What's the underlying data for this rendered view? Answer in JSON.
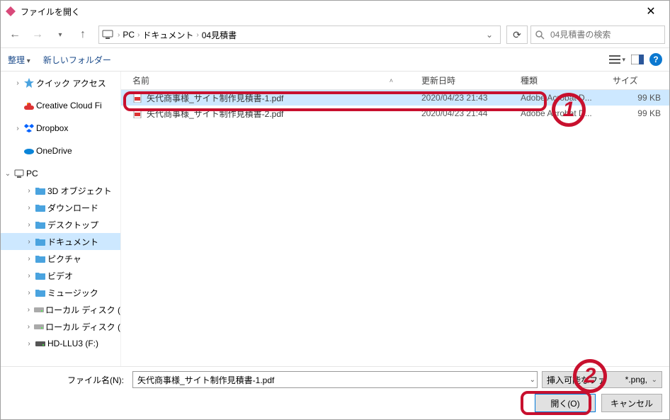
{
  "window_title": "ファイルを開く",
  "breadcrumb": {
    "icon": "pc",
    "parts": [
      "PC",
      "ドキュメント",
      "04見積書"
    ]
  },
  "search_placeholder": "04見積書の検索",
  "toolbar": {
    "organize": "整理",
    "newfolder": "新しいフォルダー"
  },
  "columns": {
    "name": "名前",
    "date": "更新日時",
    "type": "種類",
    "size": "サイズ"
  },
  "files": [
    {
      "name": "矢代商事様_サイト制作見積書-1.pdf",
      "date": "2020/04/23 21:43",
      "type": "Adobe Acrobat D...",
      "size": "99 KB",
      "selected": true
    },
    {
      "name": "矢代商事様_サイト制作見積書-2.pdf",
      "date": "2020/04/23 21:44",
      "type": "Adobe Acrobat D...",
      "size": "99 KB",
      "selected": false
    }
  ],
  "sidebar": {
    "quick_access": "クイック アクセス",
    "creative_cloud": "Creative Cloud Fi",
    "dropbox": "Dropbox",
    "onedrive": "OneDrive",
    "pc": "PC",
    "children": [
      "3D オブジェクト",
      "ダウンロード",
      "デスクトップ",
      "ドキュメント",
      "ピクチャ",
      "ビデオ",
      "ミュージック",
      "ローカル ディスク (",
      "ローカル ディスク (",
      "HD-LLU3 (F:)"
    ],
    "selected_index": 3
  },
  "bottom": {
    "filename_label": "ファイル名(N):",
    "filename_value": "矢代商事様_サイト制作見積書-1.pdf",
    "filter_label": "挿入可能なファイル(*.png, ...)",
    "filter_display": "挿入可能なファ",
    "filter_tail": "*.png,",
    "open": "開く(O)",
    "cancel": "キャンセル"
  },
  "annotations": {
    "1": "1",
    "2": "2"
  }
}
